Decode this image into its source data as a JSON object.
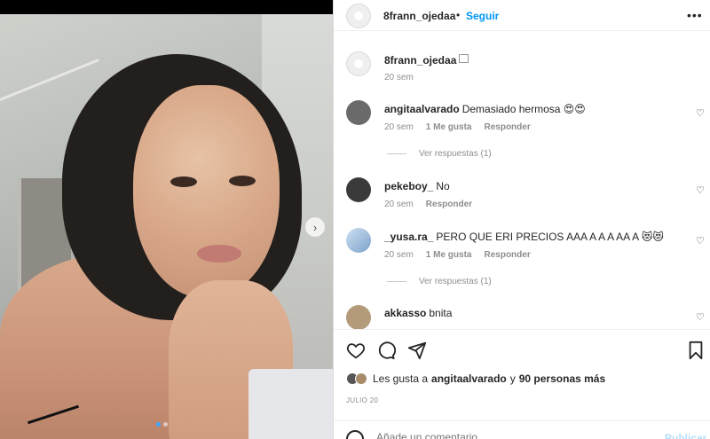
{
  "header": {
    "username": "8frann_ojedaa",
    "separator": "•",
    "follow_label": "Seguir",
    "more_icon": "more-horizontal-icon"
  },
  "caption": {
    "username": "8frann_ojedaa",
    "time": "20 sem"
  },
  "comments": [
    {
      "username": "angitaalvarado",
      "text": "Demasiado hermosa 😍😍",
      "time": "20 sem",
      "likes": "1 Me gusta",
      "reply": "Responder",
      "view_replies": "Ver respuestas (1)",
      "avatar_color": "#6a6a6a"
    },
    {
      "username": "pekeboy_",
      "text": "No",
      "time": "20 sem",
      "likes": "",
      "reply": "Responder",
      "view_replies": "",
      "avatar_color": "#3a3a3a"
    },
    {
      "username": "_yusa.ra_",
      "text": "PERO QUE ERI PRECIOS AAA A A A AA A 😻😻",
      "time": "20 sem",
      "likes": "1 Me gusta",
      "reply": "Responder",
      "view_replies": "Ver respuestas (1)",
      "avatar_color": "#8fb4d9"
    },
    {
      "username": "akkasso",
      "text": "bnita",
      "time": "",
      "likes": "",
      "reply": "",
      "view_replies": "",
      "avatar_color": "#b39a7a"
    }
  ],
  "actions": {
    "like_icon": "heart-icon",
    "comment_icon": "comment-icon",
    "share_icon": "send-icon",
    "save_icon": "bookmark-icon"
  },
  "likes": {
    "prefix": "Les gusta a",
    "user": "angitaalvarado",
    "conj": "y",
    "others": "90 personas más"
  },
  "date": "JULIO 20",
  "add_comment": {
    "placeholder": "Añade un comentario...",
    "publish": "Publicar"
  },
  "carousel": {
    "next_icon": "chevron-right-icon",
    "current": 1,
    "total": 2
  },
  "colors": {
    "accent": "#0095f6",
    "muted": "#8e8e8e",
    "text": "#262626"
  }
}
